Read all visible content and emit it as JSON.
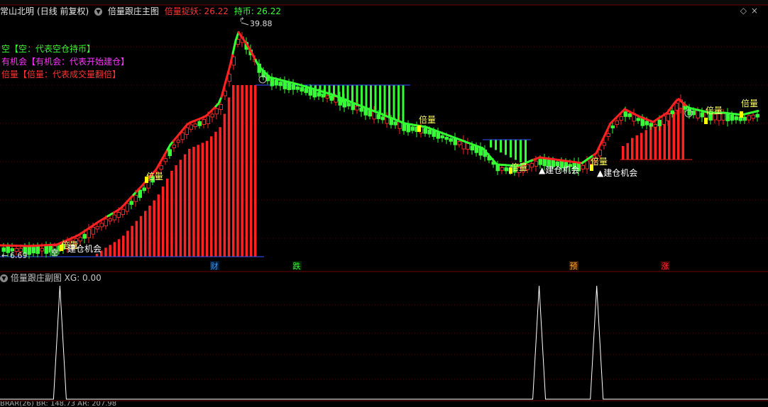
{
  "main_header": {
    "stock_name": "常山北明",
    "period": "(日线 前复权)",
    "indicator": "倍量跟庄主图",
    "label1": "倍量捉妖: 26.22",
    "label2": "持币: 26.22"
  },
  "top_right_icons": [
    "diamond-icon",
    "close-icon"
  ],
  "top_right_glyphs": "◇×",
  "legend": [
    {
      "text": "空【空：代表空仓持币】",
      "color": "#33ff33"
    },
    {
      "text": "有机会【有机会：代表开始建仓】",
      "color": "#ff33ff"
    },
    {
      "text": "倍量【倍量：代表成交量翻倍】",
      "color": "#ff3333"
    }
  ],
  "price_labels": {
    "high": "39.88",
    "low": "6.69"
  },
  "annotations": {
    "beiliang": "倍量",
    "jiancang": "建仓机会",
    "jiancang_arrow": "▲建仓机会",
    "kong": "空"
  },
  "event_markers": [
    {
      "label": "财",
      "color": "#3399ff",
      "bg": "#001a33"
    },
    {
      "label": "跌",
      "color": "#33ff33",
      "bg": "#002200"
    },
    {
      "label": "预",
      "color": "#ffaa33",
      "bg": "#331a00"
    },
    {
      "label": "涨",
      "color": "#ff3333",
      "bg": "#330000"
    }
  ],
  "sub_header": {
    "indicator": "倍量跟庄副图",
    "xg_label": "XG: 0.00"
  },
  "bottom_text": "BRAR(26)  BR: 148.73  AR: 207.98",
  "colors": {
    "up": "#ff2222",
    "down": "#33ff33",
    "ma_up": "#ff2222",
    "ma_down": "#33ff33",
    "grid": "#5a0000",
    "yellow": "#ffff00"
  },
  "chart_data": [
    {
      "type": "candlestick",
      "title": "倍量跟庄主图",
      "price_range_shown": [
        6.69,
        39.88
      ],
      "series": [
        {
          "name": "倍量捉妖",
          "values": [
            26.22
          ]
        },
        {
          "name": "持币",
          "values": [
            26.22
          ]
        }
      ]
    },
    {
      "type": "line",
      "title": "倍量跟庄副图",
      "series": [
        {
          "name": "XG",
          "values": [
            0.0
          ]
        }
      ],
      "ylim": [
        0,
        1
      ],
      "signal_positions_approx": [
        0.078,
        0.702,
        0.777
      ]
    }
  ]
}
